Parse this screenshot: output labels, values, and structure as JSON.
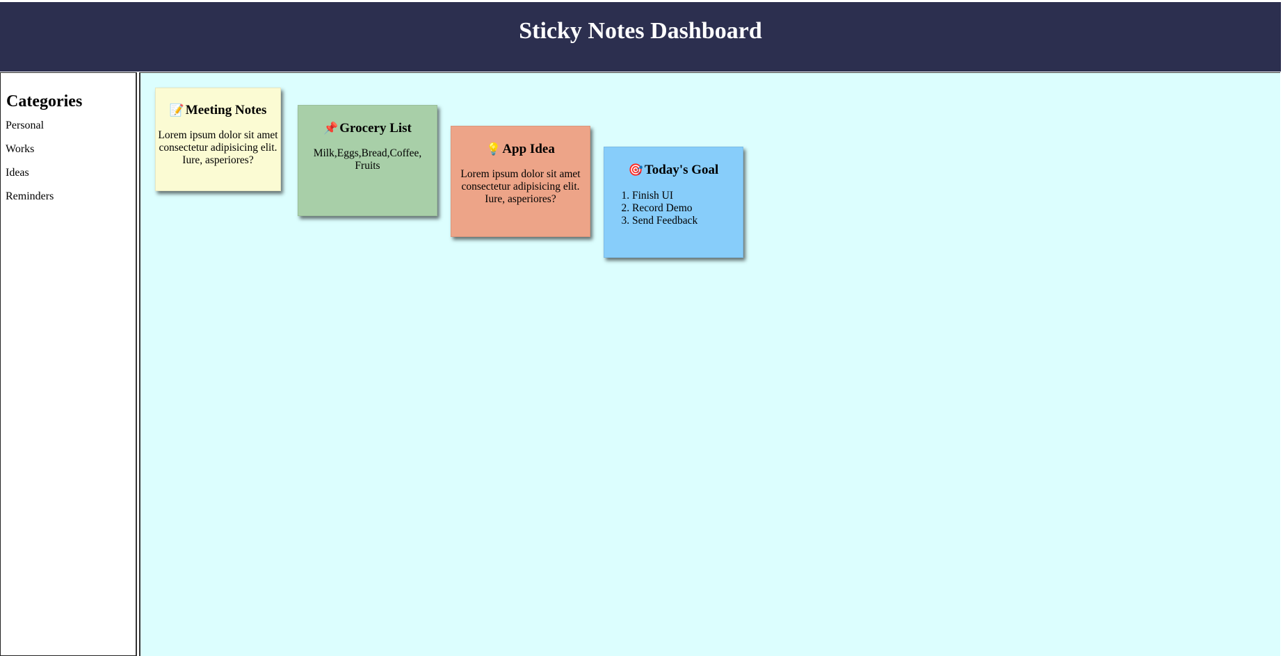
{
  "header": {
    "title": "Sticky Notes Dashboard"
  },
  "sidebar": {
    "heading": "Categories",
    "items": [
      {
        "label": "Personal"
      },
      {
        "label": "Works"
      },
      {
        "label": "Ideas"
      },
      {
        "label": "Reminders"
      }
    ]
  },
  "notes": [
    {
      "icon": "📝",
      "icon_name": "memo-icon",
      "title": "Meeting Notes",
      "body": "Lorem ipsum dolor sit amet consectetur adipisicing elit. Iure, asperiores?",
      "color": "#fbfbd3"
    },
    {
      "icon": "📌",
      "icon_name": "pushpin-icon",
      "title": "Grocery List",
      "body": "Milk,Eggs,Bread,Coffee, Fruits",
      "color": "#a8cfa8"
    },
    {
      "icon": "💡",
      "icon_name": "lightbulb-icon",
      "title": "App Idea",
      "body": "Lorem ipsum dolor sit amet consectetur adipisicing elit. Iure, asperiores?",
      "color": "#eda488"
    },
    {
      "icon": "🎯",
      "icon_name": "target-icon",
      "title": "Today's Goal",
      "items": [
        "Finish UI",
        "Record Demo",
        "Send Feedback"
      ],
      "color": "#87cdfa"
    }
  ],
  "colors": {
    "header_bg": "#2c2f4f",
    "main_bg": "#dcfefe"
  }
}
